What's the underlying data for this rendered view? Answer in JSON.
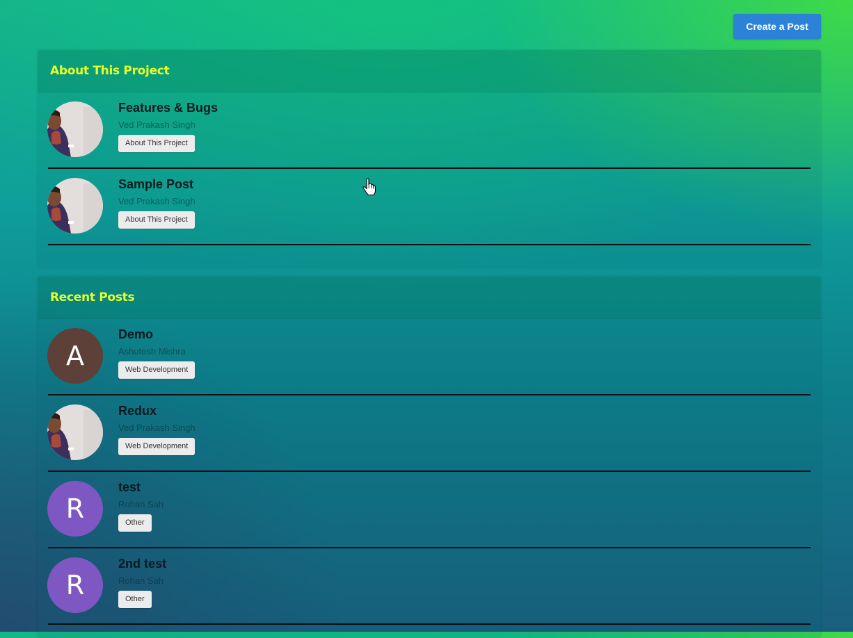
{
  "header": {
    "create_post_label": "Create a Post"
  },
  "about_section": {
    "title": "About This Project",
    "posts": [
      {
        "title": "Features & Bugs",
        "author": "Ved Prakash Singh",
        "category": "About This Project",
        "avatar": {
          "type": "photo",
          "icon": "user-photo"
        }
      },
      {
        "title": "Sample Post",
        "author": "Ved Prakash Singh",
        "category": "About This Project",
        "avatar": {
          "type": "photo",
          "icon": "user-photo"
        }
      }
    ]
  },
  "recent_section": {
    "title": "Recent Posts",
    "posts": [
      {
        "title": "Demo",
        "author": "Ashutosh Mishra",
        "category": "Web Development",
        "avatar": {
          "type": "letter",
          "letter": "A",
          "color": "#5d4037"
        }
      },
      {
        "title": "Redux",
        "author": "Ved Prakash Singh",
        "category": "Web Development",
        "avatar": {
          "type": "photo",
          "icon": "user-photo"
        }
      },
      {
        "title": "test",
        "author": "Rohan Sah",
        "category": "Other",
        "avatar": {
          "type": "letter",
          "letter": "R",
          "color": "#7e57c2"
        }
      },
      {
        "title": "2nd test",
        "author": "Rohan Sah",
        "category": "Other",
        "avatar": {
          "type": "letter",
          "letter": "R",
          "color": "#7e57c2"
        }
      }
    ]
  },
  "colors": {
    "accent_button": "#2b82d6",
    "section_title": "#e8ff2a",
    "divider": "#0a0f12",
    "tag_background": "#ececec"
  }
}
